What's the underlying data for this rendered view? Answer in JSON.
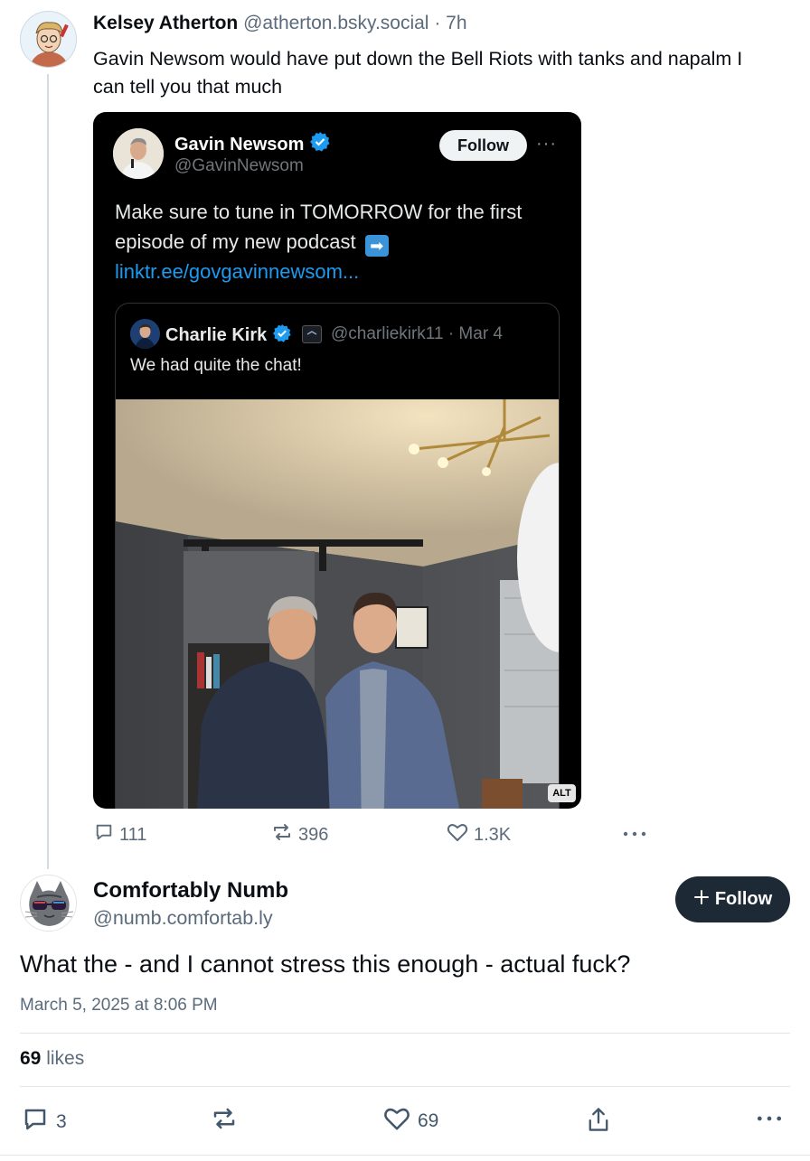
{
  "parent_post": {
    "author_name": "Kelsey Atherton",
    "author_handle": "@atherton.bsky.social",
    "time": "7h",
    "text": "Gavin Newsom would have put down the Bell Riots with tanks and napalm I can tell you that much",
    "embed": {
      "author_name": "Gavin Newsom",
      "author_handle": "@GavinNewsom",
      "follow_label": "Follow",
      "more_label": "···",
      "text": "Make sure to tune in TOMORROW for the first episode of my new podcast",
      "link": "linktr.ee/govgavinnewsom...",
      "quote": {
        "author_name": "Charlie Kirk",
        "author_handle": "@charliekirk11",
        "date": "Mar 4",
        "text": "We had quite the chat!"
      },
      "alt_label": "ALT"
    },
    "actions": {
      "replies": "111",
      "reposts": "396",
      "likes": "1.3K"
    }
  },
  "main_post": {
    "author_name": "Comfortably Numb",
    "author_handle": "@numb.comfortab.ly",
    "follow_label": "Follow",
    "text": "What the - and I cannot stress this enough - actual fuck?",
    "timestamp": "March 5, 2025 at 8:06 PM",
    "likes_count": "69",
    "likes_word": "likes",
    "actions": {
      "replies": "3",
      "likes": "69"
    }
  },
  "colors": {
    "accent_dark": "#1e2936",
    "muted": "#5b6b7b",
    "x_link": "#1d9bf0",
    "verified": "#1d9bf0"
  }
}
